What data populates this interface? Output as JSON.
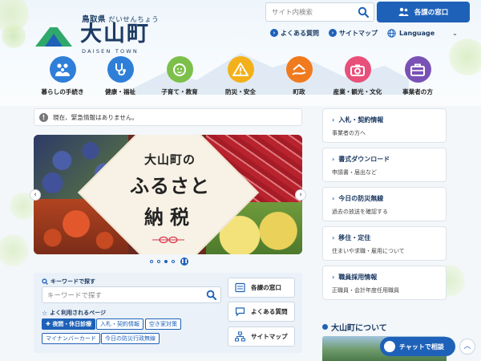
{
  "header": {
    "logo": {
      "prefecture": "鳥取県",
      "prefecture_kana": "だいせんちょう",
      "title": "大山町",
      "english": "DAISEN TOWN"
    },
    "search": {
      "placeholder": "サイト内検索"
    },
    "dept_button": "各課の窓口",
    "util_links": [
      {
        "label": "よくある質問"
      },
      {
        "label": "サイトマップ"
      }
    ],
    "language": "Language"
  },
  "categories": [
    {
      "label": "暮らしの手続き",
      "color": "#2f7fd8",
      "icon": "family-icon"
    },
    {
      "label": "健康・福祉",
      "color": "#2f7fd8",
      "icon": "stethoscope-icon"
    },
    {
      "label": "子育て・教育",
      "color": "#7cc04b",
      "icon": "child-icon"
    },
    {
      "label": "防災・安全",
      "color": "#f4b01a",
      "icon": "warning-icon"
    },
    {
      "label": "町政",
      "color": "#f07a1e",
      "icon": "hand-building-icon"
    },
    {
      "label": "産業・観光・文化",
      "color": "#e8507a",
      "icon": "camera-icon"
    },
    {
      "label": "事業者の方",
      "color": "#7a52b6",
      "icon": "briefcase-icon"
    }
  ],
  "emergency": {
    "text": "現在、緊急情報はありません。"
  },
  "slider": {
    "line1": "大山町の",
    "line2": "ふるさと",
    "line3": "納税",
    "slide_count": 4,
    "active_index": 2
  },
  "keyword": {
    "heading": "キーワードで探す",
    "placeholder": "キーワードで探す",
    "frequent_heading": "よく利用されるページ",
    "tags": [
      {
        "label": "夜間・休日診療",
        "primary": true
      },
      {
        "label": "入札・契約情報",
        "primary": false
      },
      {
        "label": "空き家対策",
        "primary": false
      },
      {
        "label": "マイナンバーカード",
        "primary": false
      },
      {
        "label": "今日の防災行政無線",
        "primary": false
      }
    ],
    "quick_links": [
      {
        "label": "各課の窓口",
        "icon": "building-icon"
      },
      {
        "label": "よくある質問",
        "icon": "speech-bubble-icon"
      },
      {
        "label": "サイトマップ",
        "icon": "sitemap-icon"
      }
    ]
  },
  "right_cards": [
    {
      "title": "入札・契約情報",
      "subtitle": "事業者の方へ"
    },
    {
      "title": "書式ダウンロード",
      "subtitle": "申請書・届出など"
    },
    {
      "title": "今日の防災無線",
      "subtitle": "過去の放送を確認する"
    },
    {
      "title": "移住・定住",
      "subtitle": "住まいや求職・雇用について"
    },
    {
      "title": "職員採用情報",
      "subtitle": "正職員・会計年度任用職員"
    }
  ],
  "about": {
    "title": "大山町について"
  },
  "chat": {
    "label": "チャットで相談"
  },
  "colors": {
    "accent": "#1e61b8",
    "navy": "#1c3a63"
  }
}
